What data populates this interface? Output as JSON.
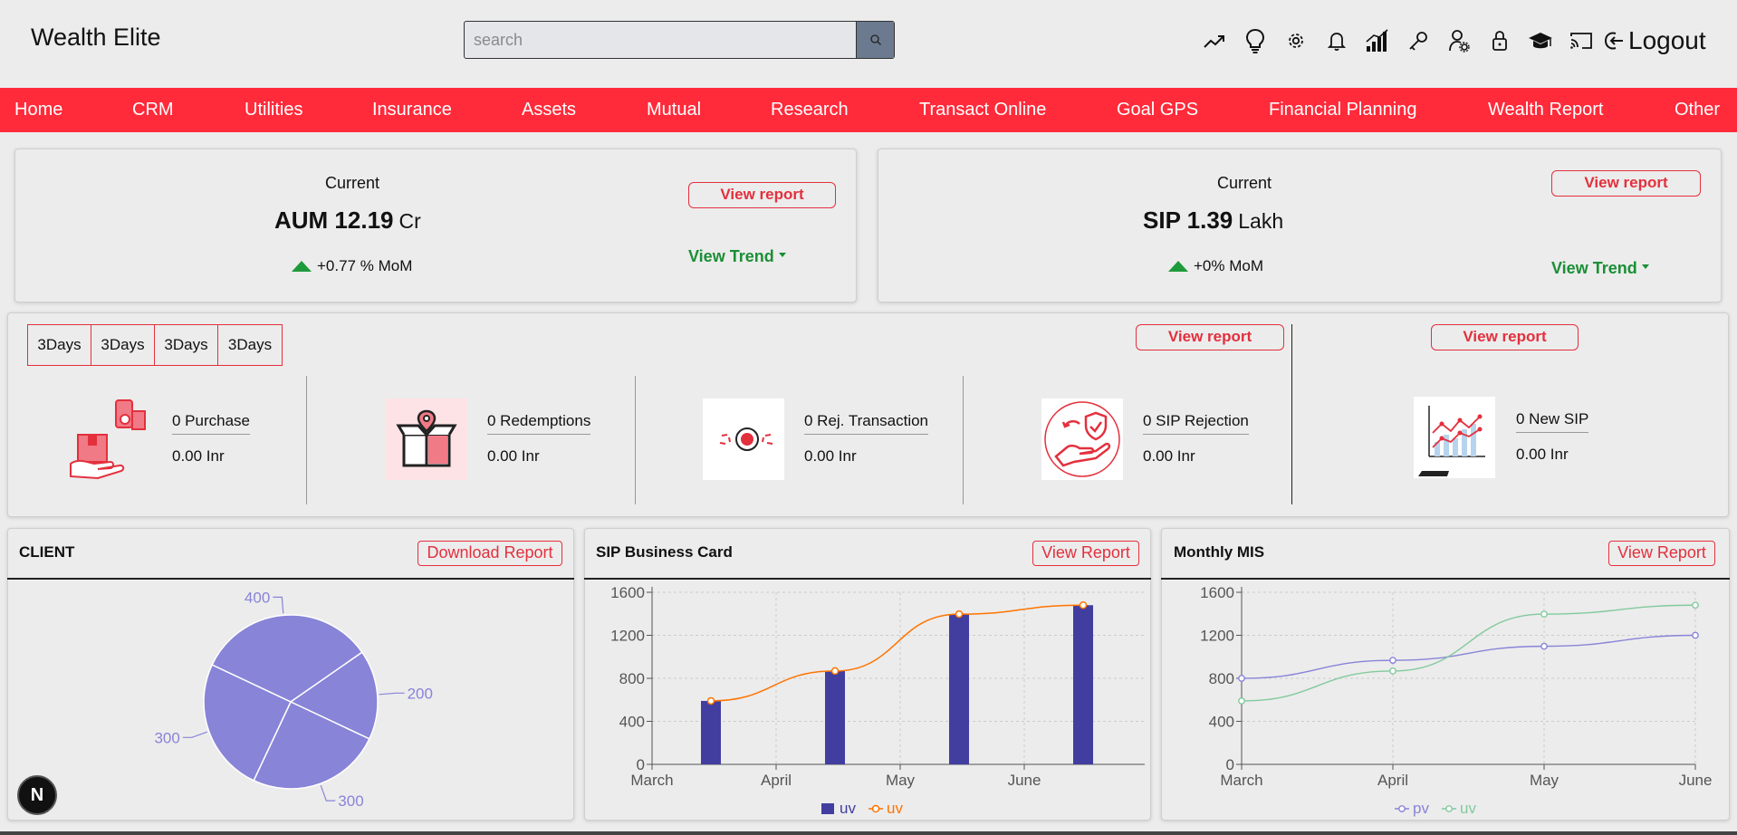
{
  "app": {
    "title": "Wealth Elite"
  },
  "search": {
    "placeholder": "search"
  },
  "header_icons": [
    "trend-up-icon",
    "bulb-icon",
    "gear-icon",
    "bell-icon",
    "signal-bars-icon",
    "key-icon",
    "user-settings-icon",
    "lock-icon",
    "graduation-cap-icon",
    "cast-icon"
  ],
  "logout_label": "Logout",
  "nav": [
    "Home",
    "CRM",
    "Utilities",
    "Insurance",
    "Assets",
    "Mutual",
    "Research",
    "Transact Online",
    "Goal GPS",
    "Financial Planning",
    "Wealth Report",
    "Other"
  ],
  "aum": {
    "current": "Current",
    "label": "AUM 12.19",
    "unit": "Cr",
    "mom": "+0.77 % MoM",
    "view_report": "View report",
    "view_trend": "View Trend"
  },
  "sip": {
    "current": "Current",
    "label": "SIP 1.39",
    "unit": "Lakh",
    "mom": "+0% MoM",
    "view_report": "View report",
    "view_trend": "View Trend"
  },
  "days_tabs": [
    "3Days",
    "3Days",
    "3Days",
    "3Days"
  ],
  "transactions": {
    "view_report_left": "View report",
    "view_report_right": "View report",
    "items": [
      {
        "label": "0 Purchase",
        "amount": "0.00 Inr",
        "icon": "purchase-icon"
      },
      {
        "label": "0 Redemptions",
        "amount": "0.00 Inr",
        "icon": "redemption-icon"
      },
      {
        "label": "0 Rej. Transaction",
        "amount": "0.00 Inr",
        "icon": "rejected-transaction-icon"
      },
      {
        "label": "0 SIP Rejection",
        "amount": "0.00 Inr",
        "icon": "sip-rejection-icon"
      },
      {
        "label": "0 New SIP",
        "amount": "0.00 Inr",
        "icon": "new-sip-chart-icon"
      }
    ]
  },
  "client_panel": {
    "title": "CLIENT",
    "button": "Download Report"
  },
  "sip_panel": {
    "title": "SIP Business Card",
    "button": "View Report"
  },
  "mis_panel": {
    "title": "Monthly MIS",
    "button": "View Report"
  },
  "chart_data": [
    {
      "type": "pie",
      "title": "CLIENT",
      "slices": [
        {
          "label": "400",
          "value": 400
        },
        {
          "label": "200",
          "value": 200
        },
        {
          "label": "300",
          "value": 300
        },
        {
          "label": "300",
          "value": 300
        }
      ],
      "color": "#8884d8"
    },
    {
      "type": "bar",
      "title": "SIP Business Card",
      "categories": [
        "March",
        "April",
        "May",
        "June"
      ],
      "series": [
        {
          "name": "uv",
          "kind": "bar",
          "values": [
            590,
            868,
            1397,
            1480
          ],
          "color": "#413ea0"
        },
        {
          "name": "uv",
          "kind": "line",
          "values": [
            590,
            868,
            1397,
            1480
          ],
          "color": "#ff7300"
        }
      ],
      "yticks": [
        0,
        400,
        800,
        1200,
        1600
      ],
      "ylim": [
        0,
        1600
      ]
    },
    {
      "type": "line",
      "title": "Monthly MIS",
      "categories": [
        "March",
        "April",
        "May",
        "June"
      ],
      "series": [
        {
          "name": "pv",
          "values": [
            800,
            967,
            1098,
            1200
          ],
          "color": "#8884d8"
        },
        {
          "name": "uv",
          "values": [
            590,
            868,
            1397,
            1480
          ],
          "color": "#82ca9d"
        }
      ],
      "yticks": [
        0,
        400,
        800,
        1200,
        1600
      ],
      "ylim": [
        0,
        1600
      ],
      "grid": true
    }
  ],
  "framework_badge": "N"
}
